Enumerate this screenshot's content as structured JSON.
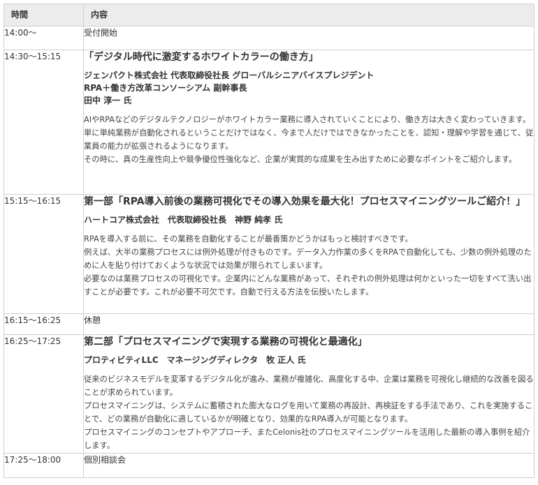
{
  "headers": {
    "time": "時間",
    "content": "内容"
  },
  "rows": [
    {
      "time": "14:00〜",
      "label": "受付開始"
    },
    {
      "time": "14:30〜15:15",
      "title": "「デジタル時代に激変するホワイトカラーの働き方」",
      "speakers": [
        "ジェンパクト株式会社 代表取締役社長 グローバルシニアバイスプレジデント",
        "RPA＋働き方改革コンソーシアム 副幹事長",
        "田中 淳一 氏"
      ],
      "description": [
        "AIやRPAなどのデジタルテクノロジーがホワイトカラー業務に導入されていくことにより、働き方は大きく変わっていきます。",
        "単に単純業務が自動化されるということだけではなく、今まで人だけではできなかったことを、認知・理解や学習を通じて、従業員の能力が拡張されるようになります。",
        "その時に、真の生産性向上や競争優位性強化など、企業が実質的な成果を生み出すために必要なポイントをご紹介します。"
      ]
    },
    {
      "time": "15:15〜16:15",
      "title": "第一部「RPA導入前後の業務可視化でその導入効果を最大化！プロセスマイニングツールご紹介！」",
      "speakers": [
        "ハートコア株式会社　代表取締役社長　神野 純孝 氏"
      ],
      "description": [
        "RPAを導入する前に、その業務を自動化することが最善策かどうかはもっと検討すべきです。",
        "例えば、大半の業務プロセスには例外処理が付きものです。データ入力作業の多くをRPAで自動化しても、少数の例外処理のために人を貼り付けておくような状況では効果が限られてしまいます。",
        "必要なのは業務プロセスの可視化です。企業内にどんな業務があって、それぞれの例外処理は何かといった一切をすべて洗い出すことが必要です。これが必要不可欠です。自動で行える方法を伝授いたします。"
      ]
    },
    {
      "time": "16:15〜16:25",
      "label": "休憩"
    },
    {
      "time": "16:25〜17:25",
      "title": "第二部「プロセスマイニングで実現する業務の可視化と最適化」",
      "speakers": [
        "プロティビティLLC　マネージングディレクタ　牧 正人 氏"
      ],
      "description": [
        "従来のビジネスモデルを変革するデジタル化が進み、業務が複雑化、高度化する中、企業は業務を可視化し継続的な改善を図ることが求められています。",
        "プロセスマイニングは、システムに蓄積された膨大なログを用いて業務の再設計、再検証をする手法であり、これを実施することで、どの業務が自動化に適しているかが明確となり、効果的なRPA導入が可能となります。",
        "プロセスマイニングのコンセプトやアプローチ、またCelonis社のプロセスマイニングツールを活用した最新の導入事例を紹介します。"
      ]
    },
    {
      "time": "17:25〜18:00",
      "label": "個別相談会"
    }
  ]
}
